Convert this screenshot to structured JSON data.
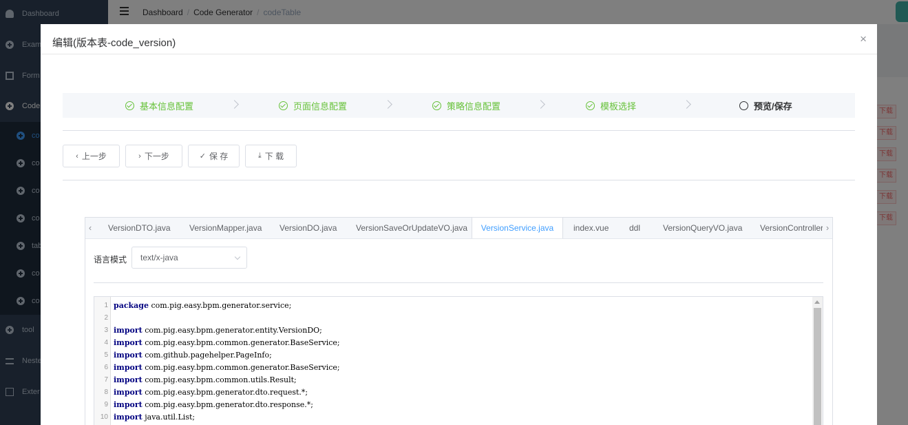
{
  "sidebar": {
    "items": [
      {
        "label": "Dashboard"
      },
      {
        "label": "Exam"
      },
      {
        "label": "Form"
      },
      {
        "label": "Code"
      },
      {
        "label": "co"
      },
      {
        "label": "co"
      },
      {
        "label": "co"
      },
      {
        "label": "co"
      },
      {
        "label": "tab"
      },
      {
        "label": "co"
      },
      {
        "label": "co"
      },
      {
        "label": "tool"
      },
      {
        "label": "Neste"
      },
      {
        "label": "Exter"
      }
    ]
  },
  "breadcrumb": {
    "items": [
      "Dashboard",
      "Code Generator"
    ],
    "current": "codeTable",
    "separator": "/"
  },
  "background_table": {
    "download_label": "下载"
  },
  "dialog": {
    "title": "编辑(版本表-code_version)",
    "close_glyph": "×",
    "steps": [
      {
        "label": "基本信息配置",
        "status": "finish"
      },
      {
        "label": "页面信息配置",
        "status": "finish"
      },
      {
        "label": "策略信息配置",
        "status": "finish"
      },
      {
        "label": "模板选择",
        "status": "finish"
      },
      {
        "label": "预览/保存",
        "status": "process"
      }
    ],
    "buttons": {
      "prev": {
        "label": "上一步",
        "icon": "‹"
      },
      "next": {
        "label": "下一步",
        "icon": "›"
      },
      "save": {
        "label": "保 存",
        "icon": "✓"
      },
      "download": {
        "label": "下 载",
        "icon": "⤓"
      }
    },
    "tabs": [
      {
        "label": "VersionDTO.java"
      },
      {
        "label": "VersionMapper.java"
      },
      {
        "label": "VersionDO.java"
      },
      {
        "label": "VersionSaveOrUpdateVO.java"
      },
      {
        "label": "VersionService.java",
        "active": true
      },
      {
        "label": "index.vue"
      },
      {
        "label": "ddl"
      },
      {
        "label": "VersionQueryVO.java"
      },
      {
        "label": "VersionController."
      }
    ],
    "tab_prev_glyph": "‹",
    "tab_next_glyph": "›",
    "language": {
      "label": "语言模式",
      "value": "text/x-java"
    },
    "code_lines": [
      {
        "num": "1",
        "kw": "package",
        "rest": " com.pig.easy.bpm.generator.service;"
      },
      {
        "num": "2",
        "kw": "",
        "rest": ""
      },
      {
        "num": "3",
        "kw": "import",
        "rest": " com.pig.easy.bpm.generator.entity.VersionDO;"
      },
      {
        "num": "4",
        "kw": "import",
        "rest": " com.pig.easy.bpm.common.generator.BaseService;"
      },
      {
        "num": "5",
        "kw": "import",
        "rest": " com.github.pagehelper.PageInfo;"
      },
      {
        "num": "6",
        "kw": "import",
        "rest": " com.pig.easy.bpm.common.generator.BaseService;"
      },
      {
        "num": "7",
        "kw": "import",
        "rest": " com.pig.easy.bpm.common.utils.Result;"
      },
      {
        "num": "8",
        "kw": "import",
        "rest": " com.pig.easy.bpm.generator.dto.request.*;"
      },
      {
        "num": "9",
        "kw": "import",
        "rest": " com.pig.easy.bpm.generator.dto.response.*;"
      },
      {
        "num": "10",
        "kw": "import",
        "rest": " java.util.List;"
      }
    ]
  }
}
